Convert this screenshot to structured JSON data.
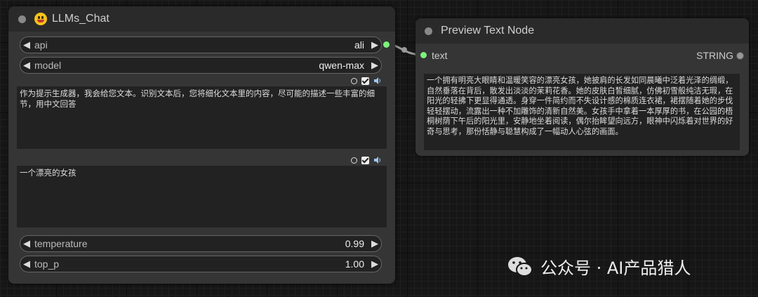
{
  "llm_node": {
    "title": "LLMs_Chat",
    "widgets": {
      "api": {
        "label": "api",
        "value": "ali"
      },
      "model": {
        "label": "model",
        "value": "qwen-max"
      },
      "temperature": {
        "label": "temperature",
        "value": "0.99"
      },
      "top_p": {
        "label": "top_p",
        "value": "1.00"
      }
    },
    "system_prompt": "作为提示生成器，我会给您文本。识别文本后，您将细化文本里的内容，尽可能的描述一些丰富的细节，用中文回答",
    "user_prompt": "一个漂亮的女孩"
  },
  "preview_node": {
    "title": "Preview Text Node",
    "input_label": "text",
    "output_label": "STRING",
    "preview_text": "一个拥有明亮大眼睛和温暖笑容的漂亮女孩，她披肩的长发如同晨曦中泛着光泽的绸缎，自然垂落在背后，散发出淡淡的茉莉花香。她的皮肤白皙细腻，仿佛初雪般纯洁无瑕，在阳光的轻拂下更显得通透。身穿一件简约而不失设计感的棉质连衣裙，裙摆随着她的步伐轻轻摆动，流露出一种不加雕饰的清新自然美。女孩手中拿着一本厚厚的书，在公园的梧桐树荫下午后的阳光里，安静地坐着阅读，偶尔抬眸望向远方，眼神中闪烁着对世界的好奇与思考，那份恬静与聪慧构成了一幅动人心弦的画面。"
  },
  "watermark": {
    "text": "公众号 · AI产品猎人"
  },
  "colors": {
    "node_bg": "#353535",
    "header_bg": "#2a2a2a",
    "slot_green": "#7cf27c",
    "canvas": "#161616"
  }
}
